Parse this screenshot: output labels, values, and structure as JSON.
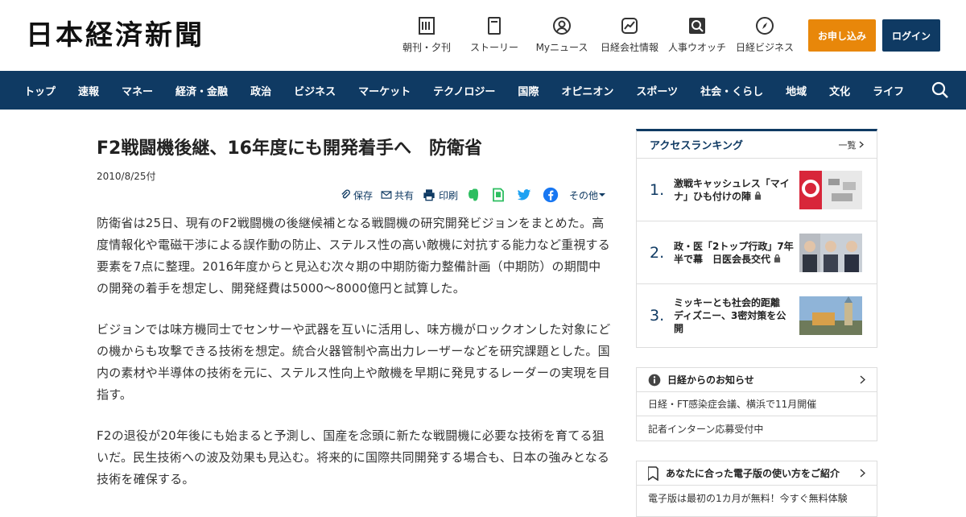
{
  "header": {
    "logo": "日本経済新聞",
    "nav": [
      {
        "label": "朝刊・夕刊",
        "icon": "newspaper-icon"
      },
      {
        "label": "ストーリー",
        "icon": "book-icon"
      },
      {
        "label": "Myニュース",
        "icon": "user-icon"
      },
      {
        "label": "日経会社情報",
        "icon": "chart-icon"
      },
      {
        "label": "人事ウオッチ",
        "icon": "search-person-icon"
      },
      {
        "label": "日経ビジネス",
        "icon": "compass-icon"
      }
    ],
    "subscribe": "お申し込み",
    "login": "ログイン"
  },
  "categories": [
    "トップ",
    "速報",
    "マネー",
    "経済・金融",
    "政治",
    "ビジネス",
    "マーケット",
    "テクノロジー",
    "国際",
    "オピニオン",
    "スポーツ",
    "社会・くらし",
    "地域",
    "文化",
    "ライフ"
  ],
  "article": {
    "title": "F2戦闘機後継、16年度にも開発着手へ　防衛省",
    "date": "2010/8/25付",
    "tools": {
      "save": "保存",
      "share": "共有",
      "print": "印刷",
      "other": "その他"
    },
    "paragraphs": [
      "防衛省は25日、現有のF2戦闘機の後継候補となる戦闘機の研究開発ビジョンをまとめた。高度情報化や電磁干渉による誤作動の防止、ステルス性の高い敵機に対抗する能力など重視する要素を7点に整理。2016年度からと見込む次々期の中期防衛力整備計画（中期防）の期間中の開発の着手を想定し、開発経費は5000～8000億円と試算した。",
      "ビジョンでは味方機同士でセンサーや武器を互いに活用し、味方機がロックオンした対象にどの機からも攻撃できる技術を想定。統合火器管制や高出力レーザーなどを研究課題とした。国内の素材や半導体の技術を元に、ステルス性向上や敵機を早期に発見するレーダーの実現を目指す。",
      "F2の退役が20年後にも始まると予測し、国産を念頭に新たな戦闘機に必要な技術を育てる狙いだ。民生技術への波及効果も見込む。将来的に国際共同開発する場合も、日本の強みとなる技術を確保する。"
    ]
  },
  "ranking": {
    "title": "アクセスランキング",
    "more": "一覧",
    "items": [
      {
        "num": "1.",
        "text": "激戦キャッシュレス「マイナ」ひも付けの陣"
      },
      {
        "num": "2.",
        "text": "政・医「2トップ行政」7年半で幕　日医会長交代"
      },
      {
        "num": "3.",
        "text": "ミッキーとも社会的距離　ディズニー、3密対策を公開"
      }
    ]
  },
  "notice": {
    "title": "日経からのお知らせ",
    "items": [
      "日経・FT感染症会議、横浜で11月開催",
      "記者インターン応募受付中"
    ]
  },
  "guide": {
    "title": "あなたに合った電子版の使い方をご紹介",
    "items": [
      "電子版は最初の1カ月が無料！今すぐ無料体験"
    ]
  },
  "colors": {
    "navy": "#0f3a63",
    "orange": "#e8870a"
  }
}
